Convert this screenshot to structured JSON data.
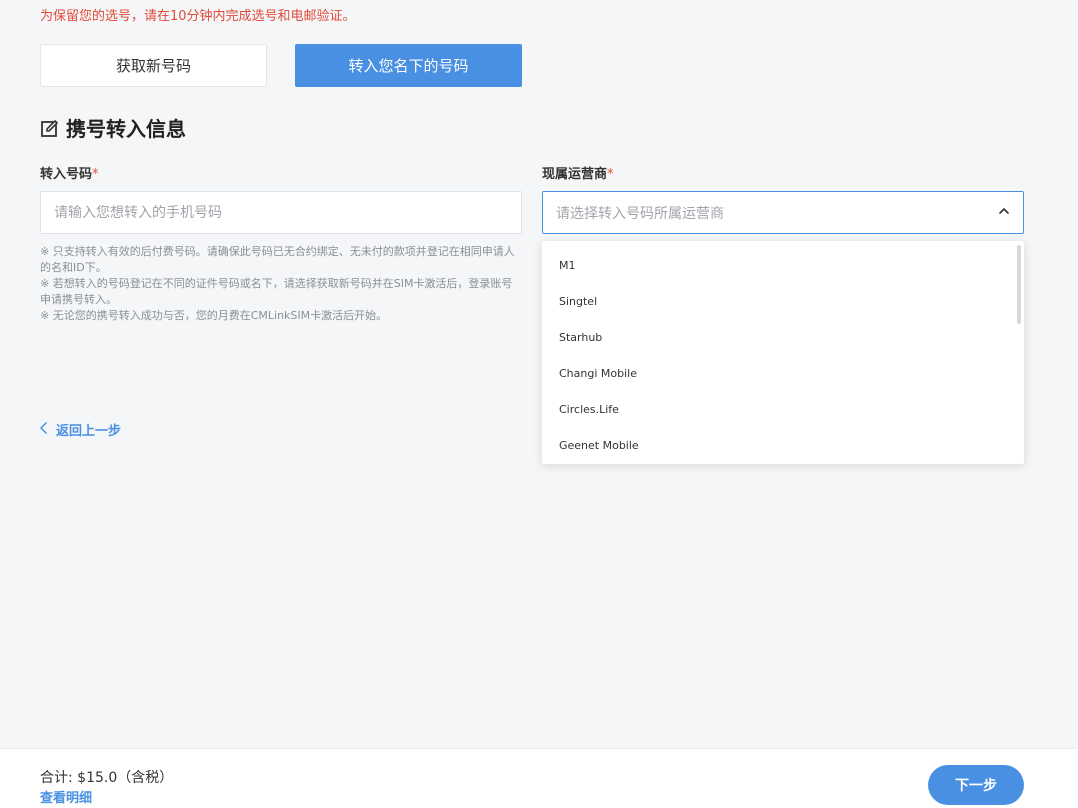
{
  "notice": "为保留您的选号，请在10分钟内完成选号和电邮验证。",
  "tabs": {
    "new_number": "获取新号码",
    "transfer_number": "转入您名下的号码"
  },
  "section": {
    "icon": "edit-icon",
    "title": "携号转入信息"
  },
  "form": {
    "number_label": "转入号码",
    "number_placeholder": "请输入您想转入的手机号码",
    "carrier_label": "现属运营商",
    "carrier_placeholder": "请选择转入号码所属运营商",
    "required_mark": "*",
    "notes": [
      "※ 只支持转入有效的后付费号码。请确保此号码已无合约绑定、无未付的款项并登记在相同申请人的名和ID下。",
      "※ 若想转入的号码登记在不同的证件号码或名下，请选择获取新号码并在SIM卡激活后，登录账号申请携号转入。",
      "※ 无论您的携号转入成功与否，您的月费在CMLinkSIM卡激活后开始。"
    ]
  },
  "dropdown": {
    "options": [
      "M1",
      "Singtel",
      "Starhub",
      "Changi Mobile",
      "Circles.Life",
      "Geenet Mobile"
    ]
  },
  "back": {
    "icon": "chevron-left-icon",
    "label": "返回上一步"
  },
  "footer": {
    "total": "合计: $15.0（含税）",
    "details": "查看明细",
    "next": "下一步"
  },
  "colors": {
    "accent": "#4a90e2",
    "warning": "#e04a3a",
    "background": "#f5f6f8"
  }
}
